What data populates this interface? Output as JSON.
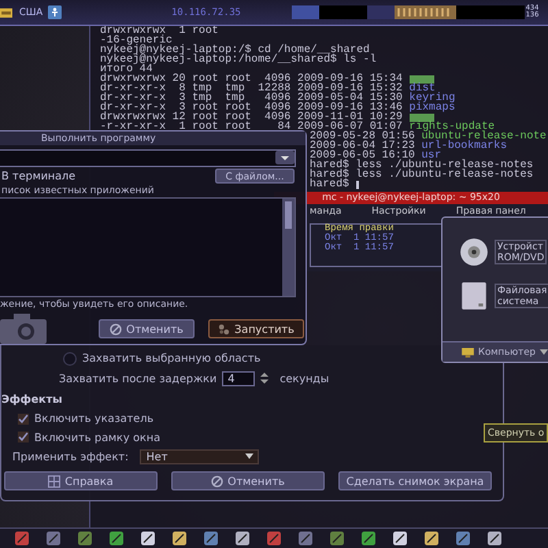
{
  "top_panel": {
    "keyboard_layout": "США",
    "ip_address": "10.116.72.35",
    "monitor_values": [
      "434",
      "136"
    ]
  },
  "terminal": {
    "lines": [
      {
        "text": "drwxrwxrwx  1 root",
        "kind": "plain"
      },
      {
        "text": "-16-generic",
        "kind": "plain"
      },
      {
        "text": "nykeej@nykeej-laptop:/$ cd /home/__shared",
        "kind": "plain"
      },
      {
        "text": "nykeej@nykeej-laptop:/home/__shared$ ls -l",
        "kind": "plain"
      },
      {
        "text": "итого 44",
        "kind": "plain"
      },
      {
        "text": "drwxrwxrwx 20 root root  4096 2009-09-16 15:34 ",
        "kind": "highlight"
      },
      {
        "text": "dr-xr-xr-x  8 tmp  tmp  12288 2009-09-16 15:32 ",
        "name": "dist",
        "kind": "dir"
      },
      {
        "text": "dr-xr-xr-x  3 tmp  tmp   4096 2009-05-04 15:30 ",
        "name": "keyring",
        "kind": "dir"
      },
      {
        "text": "dr-xr-xr-x  3 root root  4096 2009-09-16 13:46 ",
        "name": "pixmaps",
        "kind": "dir"
      },
      {
        "text": "drwxrwxrwx 12 root root  4096 2009-11-01 10:29 ",
        "kind": "highlight"
      },
      {
        "text": "-r-xr-xr-x  1 root root    84 2009-06-07 01:07 ",
        "name": "rights-update",
        "kind": "exec"
      }
    ],
    "tail_lines": [
      {
        "text": "2009-05-28 01:56 ",
        "name": "ubuntu-release-note",
        "kind": "exec"
      },
      {
        "text": "2009-06-04 17:23 ",
        "name": "url-bookmarks",
        "kind": "dir"
      },
      {
        "text": "2009-06-05 16:10 ",
        "name": "usr",
        "kind": "dir"
      },
      {
        "text": "hared$ less ./ubuntu-release-notes",
        "kind": "plain"
      },
      {
        "text": "hared$ less ./ubuntu-release-notes",
        "kind": "plain"
      },
      {
        "text": "hared$ ",
        "kind": "cursor"
      }
    ]
  },
  "run_dialog": {
    "title": "Выполнить программу",
    "in_terminal": "В терминале",
    "file_button": "С файлом...",
    "list_expander": "писок известных приложений",
    "hint": "жение, чтобы увидеть его описание.",
    "buttons": [
      {
        "label": "Отменить",
        "kind": "cancel"
      },
      {
        "label": "Запустить",
        "kind": "run"
      }
    ]
  },
  "mc": {
    "title": "mc - nykeej@nykeej-laptop: ~ 95x20",
    "menu": [
      "манда",
      "Настройки",
      "Правая панел"
    ],
    "column_header": "Время правки",
    "rows": [
      "Окт  1 11:57",
      "Окт  1 11:57"
    ]
  },
  "computer_window": {
    "items": [
      {
        "lines": [
          "Устройст",
          "ROM/DVD"
        ],
        "kind": "optical"
      },
      {
        "lines": [
          "Файловая",
          "система"
        ],
        "kind": "disk"
      }
    ],
    "location": "Компьютер"
  },
  "screenshot_dialog": {
    "area_option": {
      "label": "Захватить выбранную область",
      "selected": false
    },
    "delay": {
      "label": "Захватить после задержки",
      "value": "4",
      "unit": "секунды"
    },
    "effects_title": "Эффекты",
    "checks": [
      {
        "label": "Включить указатель",
        "checked": true
      },
      {
        "label": "Включить рамку окна",
        "checked": true
      }
    ],
    "effect": {
      "label": "Применить эффект:",
      "value": "Нет"
    },
    "buttons": [
      {
        "label": "Справка",
        "kind": "help"
      },
      {
        "label": "Отменить",
        "kind": "cancel"
      },
      {
        "label": "Сделать снимок экрана",
        "kind": "capture"
      }
    ]
  },
  "tooltip": "Свернуть о"
}
